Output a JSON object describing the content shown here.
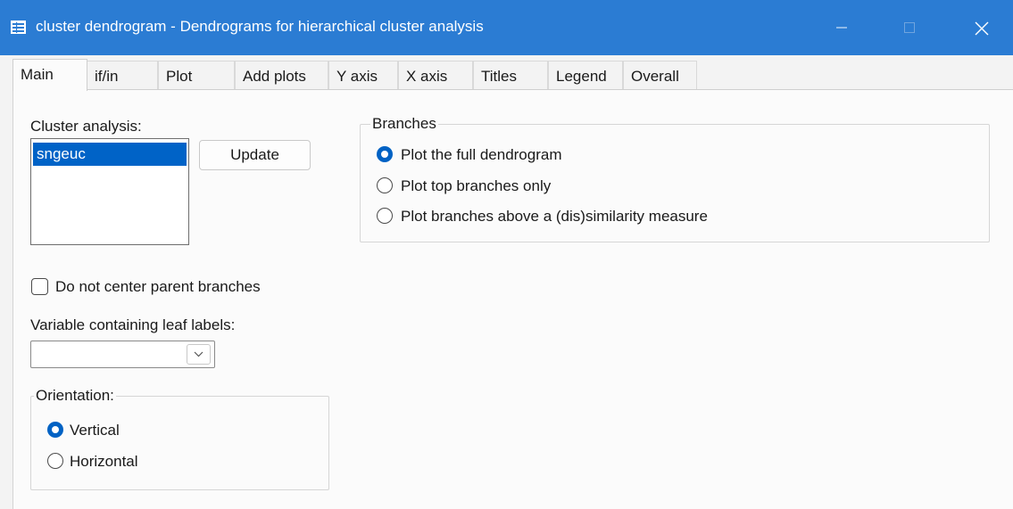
{
  "window": {
    "title": "cluster dendrogram - Dendrograms for hierarchical cluster analysis",
    "icon": "dialog-table-icon",
    "controls": [
      "minimize-icon",
      "maximize-icon",
      "close-icon"
    ],
    "accent": "#2b7cd3"
  },
  "tabs": [
    {
      "label": "Main",
      "active": true
    },
    {
      "label": "if/in"
    },
    {
      "label": "Plot"
    },
    {
      "label": "Add plots"
    },
    {
      "label": "Y axis"
    },
    {
      "label": "X axis"
    },
    {
      "label": "Titles"
    },
    {
      "label": "Legend"
    },
    {
      "label": "Overall"
    }
  ],
  "main": {
    "cluster_label": "Cluster analysis:",
    "cluster_items": [
      {
        "label": "sngeuc",
        "selected": true
      }
    ],
    "update_label": "Update",
    "center_checkbox": {
      "label": "Do not center parent branches",
      "checked": false
    },
    "leaf_label": "Variable containing leaf labels:",
    "leaf_value": "",
    "orientation": {
      "title": "Orientation:",
      "options": [
        {
          "label": "Vertical",
          "selected": true
        },
        {
          "label": "Horizontal",
          "selected": false
        }
      ]
    },
    "branches": {
      "title": "Branches",
      "options": [
        {
          "label": "Plot the full dendrogram",
          "selected": true
        },
        {
          "label": "Plot top branches only",
          "selected": false
        },
        {
          "label": "Plot branches above a (dis)similarity measure",
          "selected": false
        }
      ]
    }
  }
}
